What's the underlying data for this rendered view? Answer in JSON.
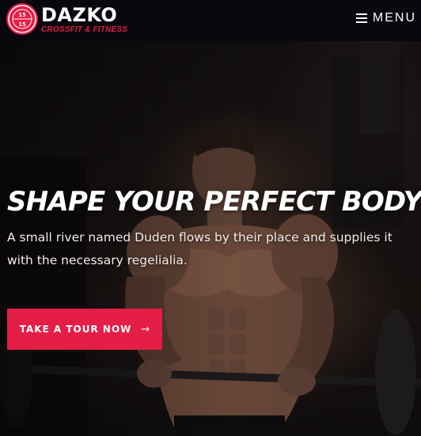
{
  "header": {
    "logo": {
      "name": "DAZKO",
      "tagline": "CROSSFIT & FITNESS",
      "badge_top": "15",
      "badge_bottom": "15"
    },
    "menu": {
      "label": "MENU",
      "icon": "hamburger-icon"
    }
  },
  "hero": {
    "headline": "SHAPE YOUR PERFECT BODY",
    "subtext": "A small river named Duden flows by their place and supplies it with the necessary regelialia.",
    "cta": {
      "label": "TAKE A TOUR NOW",
      "icon": "arrow-right-icon",
      "arrow": "→"
    },
    "background_image": "athlete-curling-barbell-photo"
  },
  "colors": {
    "accent": "#e41e47",
    "header_bg": "#08080e",
    "text": "#ffffff"
  }
}
